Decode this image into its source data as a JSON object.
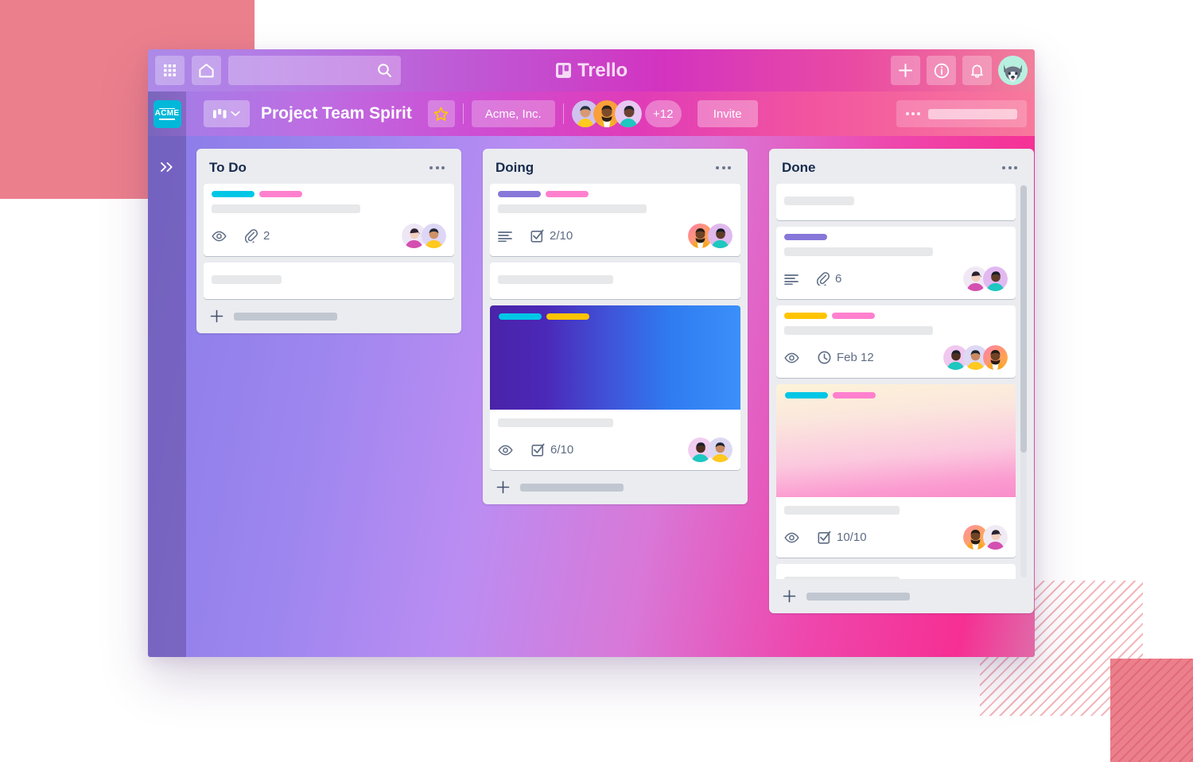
{
  "app": {
    "brand_name": "Trello",
    "brand_icon": "trello-board-icon"
  },
  "top_nav": {
    "apps_button": {
      "icon": "grid-apps-icon",
      "label": ""
    },
    "home_button": {
      "icon": "home-icon",
      "label": ""
    },
    "search": {
      "value": "",
      "placeholder": "",
      "icon": "search-icon"
    },
    "add_button": {
      "icon": "plus-icon",
      "label": ""
    },
    "info_button": {
      "icon": "info-circle-icon",
      "label": ""
    },
    "notifications_button": {
      "icon": "bell-icon",
      "label": ""
    },
    "profile_avatar": {
      "icon": "husky-dog-avatar",
      "label": ""
    }
  },
  "board_bar": {
    "workspace_logo_text": "ACME",
    "view_switcher": {
      "icon": "board-view-icon",
      "chevron": "chevron-down-icon"
    },
    "board_title": "Project Team Spirit",
    "star_button": {
      "icon": "star-icon",
      "color": "#FFC400"
    },
    "organization": "Acme, Inc.",
    "members_extra_count": "+12",
    "invite_label": "Invite",
    "menu_icon": "ellipsis-horizontal-icon"
  },
  "sidebar": {
    "expand_icon": "chevron-double-right-icon"
  },
  "colors": {
    "label_cyan": "#00C7E6",
    "label_pink": "#FF80CE",
    "label_purple": "#8777D9",
    "label_yellow": "#FFC400",
    "list_background": "#EBECF0",
    "card_background": "#FFFFFF",
    "text_dark": "#172B4D",
    "text_muted": "#5E6C84",
    "acme_logo": "#00B8D9"
  },
  "lists": [
    {
      "title": "To Do",
      "menu_icon": "ellipsis-horizontal-icon",
      "add_card_label": "",
      "add_card_icon": "plus-icon",
      "cards": [
        {
          "labels": [
            "#00C7E6",
            "#FF80CE"
          ],
          "title_placeholder_width": "long",
          "badges": [
            {
              "icon": "eye-icon",
              "text": ""
            },
            {
              "icon": "paperclip-icon",
              "text": "2"
            }
          ],
          "avatars": [
            "avatar-woman-purple",
            "avatar-person-yellow"
          ],
          "cover": null
        },
        {
          "labels": [],
          "title_placeholder_width": "short",
          "badges": [],
          "avatars": [],
          "cover": null
        }
      ]
    },
    {
      "title": "Doing",
      "menu_icon": "ellipsis-horizontal-icon",
      "add_card_label": "",
      "add_card_icon": "plus-icon",
      "cards": [
        {
          "labels": [
            "#8777D9",
            "#FF80CE"
          ],
          "title_placeholder_width": "long",
          "badges": [
            {
              "icon": "description-lines-icon",
              "text": ""
            },
            {
              "icon": "checklist-icon",
              "text": "2/10"
            }
          ],
          "avatars": [
            "avatar-man-beard-orange",
            "avatar-person-teal"
          ],
          "cover": null
        },
        {
          "labels": [],
          "title_placeholder_width": "mid",
          "badges": [],
          "avatars": [],
          "cover": null
        },
        {
          "labels": [
            "#00C7E6",
            "#FFC400"
          ],
          "title_placeholder_width": "mid",
          "badges": [
            {
              "icon": "eye-icon",
              "text": ""
            },
            {
              "icon": "checklist-icon",
              "text": "6/10"
            }
          ],
          "avatars": [
            "avatar-person-teal",
            "avatar-person-yellow"
          ],
          "cover": "gradient-blue-violet"
        }
      ]
    },
    {
      "title": "Done",
      "menu_icon": "ellipsis-horizontal-icon",
      "add_card_label": "",
      "add_card_icon": "plus-icon",
      "scrollbar_visible": true,
      "cards": [
        {
          "labels": [],
          "title_placeholder_width": "short",
          "badges": [],
          "avatars": [],
          "cover": null
        },
        {
          "labels": [
            "#8777D9"
          ],
          "title_placeholder_width": "long",
          "badges": [
            {
              "icon": "description-lines-icon",
              "text": ""
            },
            {
              "icon": "paperclip-icon",
              "text": "6"
            }
          ],
          "avatars": [
            "avatar-woman-purple",
            "avatar-person-teal"
          ],
          "cover": null
        },
        {
          "labels": [
            "#FFC400",
            "#FF80CE"
          ],
          "title_placeholder_width": "long",
          "badges": [
            {
              "icon": "eye-icon",
              "text": ""
            },
            {
              "icon": "clock-icon",
              "text": "Feb 12"
            }
          ],
          "avatars": [
            "avatar-person-teal",
            "avatar-person-yellow",
            "avatar-man-beard-orange"
          ],
          "cover": null
        },
        {
          "labels": [
            "#00C7E6",
            "#FF80CE"
          ],
          "title_placeholder_width": "mid",
          "badges": [
            {
              "icon": "eye-icon",
              "text": ""
            },
            {
              "icon": "checklist-icon",
              "text": "10/10"
            }
          ],
          "avatars": [
            "avatar-man-beard-orange",
            "avatar-woman-purple"
          ],
          "cover": "gradient-cream-pink"
        },
        {
          "labels": [],
          "title_placeholder_width": "mid",
          "badges": [],
          "avatars": [],
          "cover": null
        }
      ]
    }
  ]
}
